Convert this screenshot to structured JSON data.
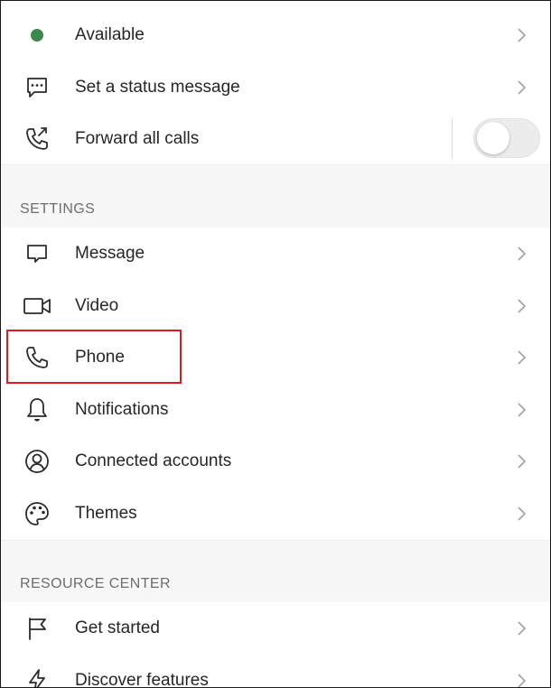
{
  "status_rows": [
    {
      "label": "Available",
      "icon": "green-dot-status-icon",
      "status_color": "#3a8a4b"
    },
    {
      "label": "Set a status message",
      "icon": "chat-bubble-dots-icon"
    },
    {
      "label": "Forward all calls",
      "icon": "phone-forward-icon",
      "toggle_on": false
    }
  ],
  "settings": {
    "title": "SETTINGS",
    "items": [
      {
        "label": "Message",
        "icon": "message-icon"
      },
      {
        "label": "Video",
        "icon": "video-camera-icon"
      },
      {
        "label": "Phone",
        "icon": "phone-icon",
        "highlighted": true
      },
      {
        "label": "Notifications",
        "icon": "bell-icon"
      },
      {
        "label": "Connected accounts",
        "icon": "user-circle-icon"
      },
      {
        "label": "Themes",
        "icon": "palette-icon"
      }
    ]
  },
  "resource_center": {
    "title": "RESOURCE CENTER",
    "items": [
      {
        "label": "Get started",
        "icon": "flag-icon"
      },
      {
        "label": "Discover features",
        "icon": "lightning-icon"
      }
    ]
  },
  "colors": {
    "highlight_border": "#e0191f",
    "section_bg": "#f7f7f7"
  }
}
